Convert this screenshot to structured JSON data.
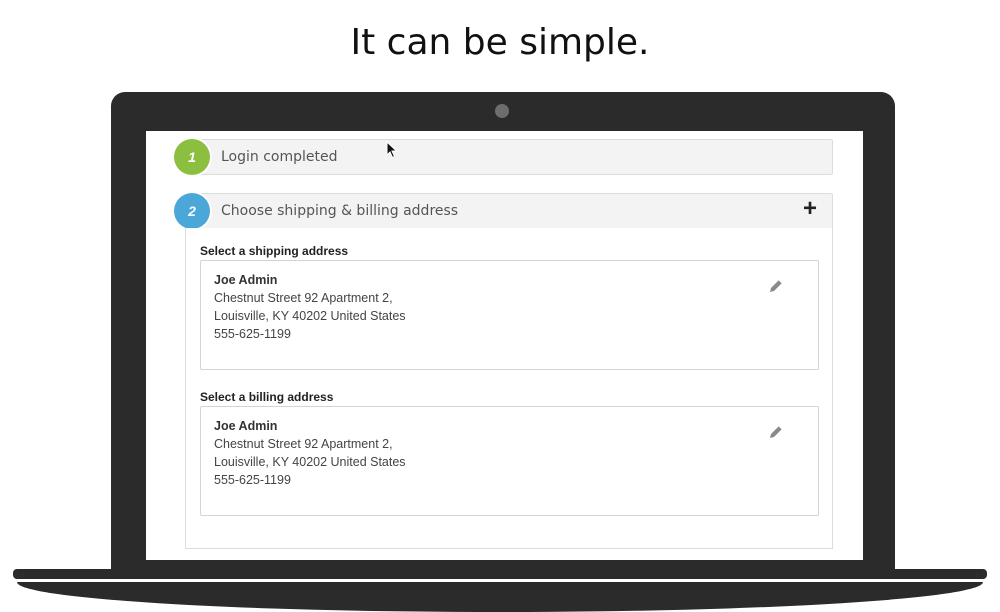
{
  "headline": "It can be simple.",
  "steps": [
    {
      "number": "1",
      "title": "Login completed"
    },
    {
      "number": "2",
      "title": "Choose shipping & billing address"
    }
  ],
  "shipping": {
    "label": "Select a shipping address",
    "name": "Joe Admin",
    "street": "Chestnut Street 92 Apartment 2,",
    "city": "Louisville, KY 40202 United States",
    "phone": "555-625-1199"
  },
  "billing": {
    "label": "Select a billing address",
    "name": "Joe Admin",
    "street": "Chestnut Street 92 Apartment 2,",
    "city": "Louisville, KY 40202 United States",
    "phone": "555-625-1199"
  },
  "icons": {
    "expand": "plus-icon",
    "edit": "pencil-icon",
    "cursor": "mouse-cursor-icon"
  },
  "colors": {
    "step1_badge": "#8cbf3f",
    "step2_badge": "#4aa7d8",
    "laptop": "#2b2b2b"
  }
}
